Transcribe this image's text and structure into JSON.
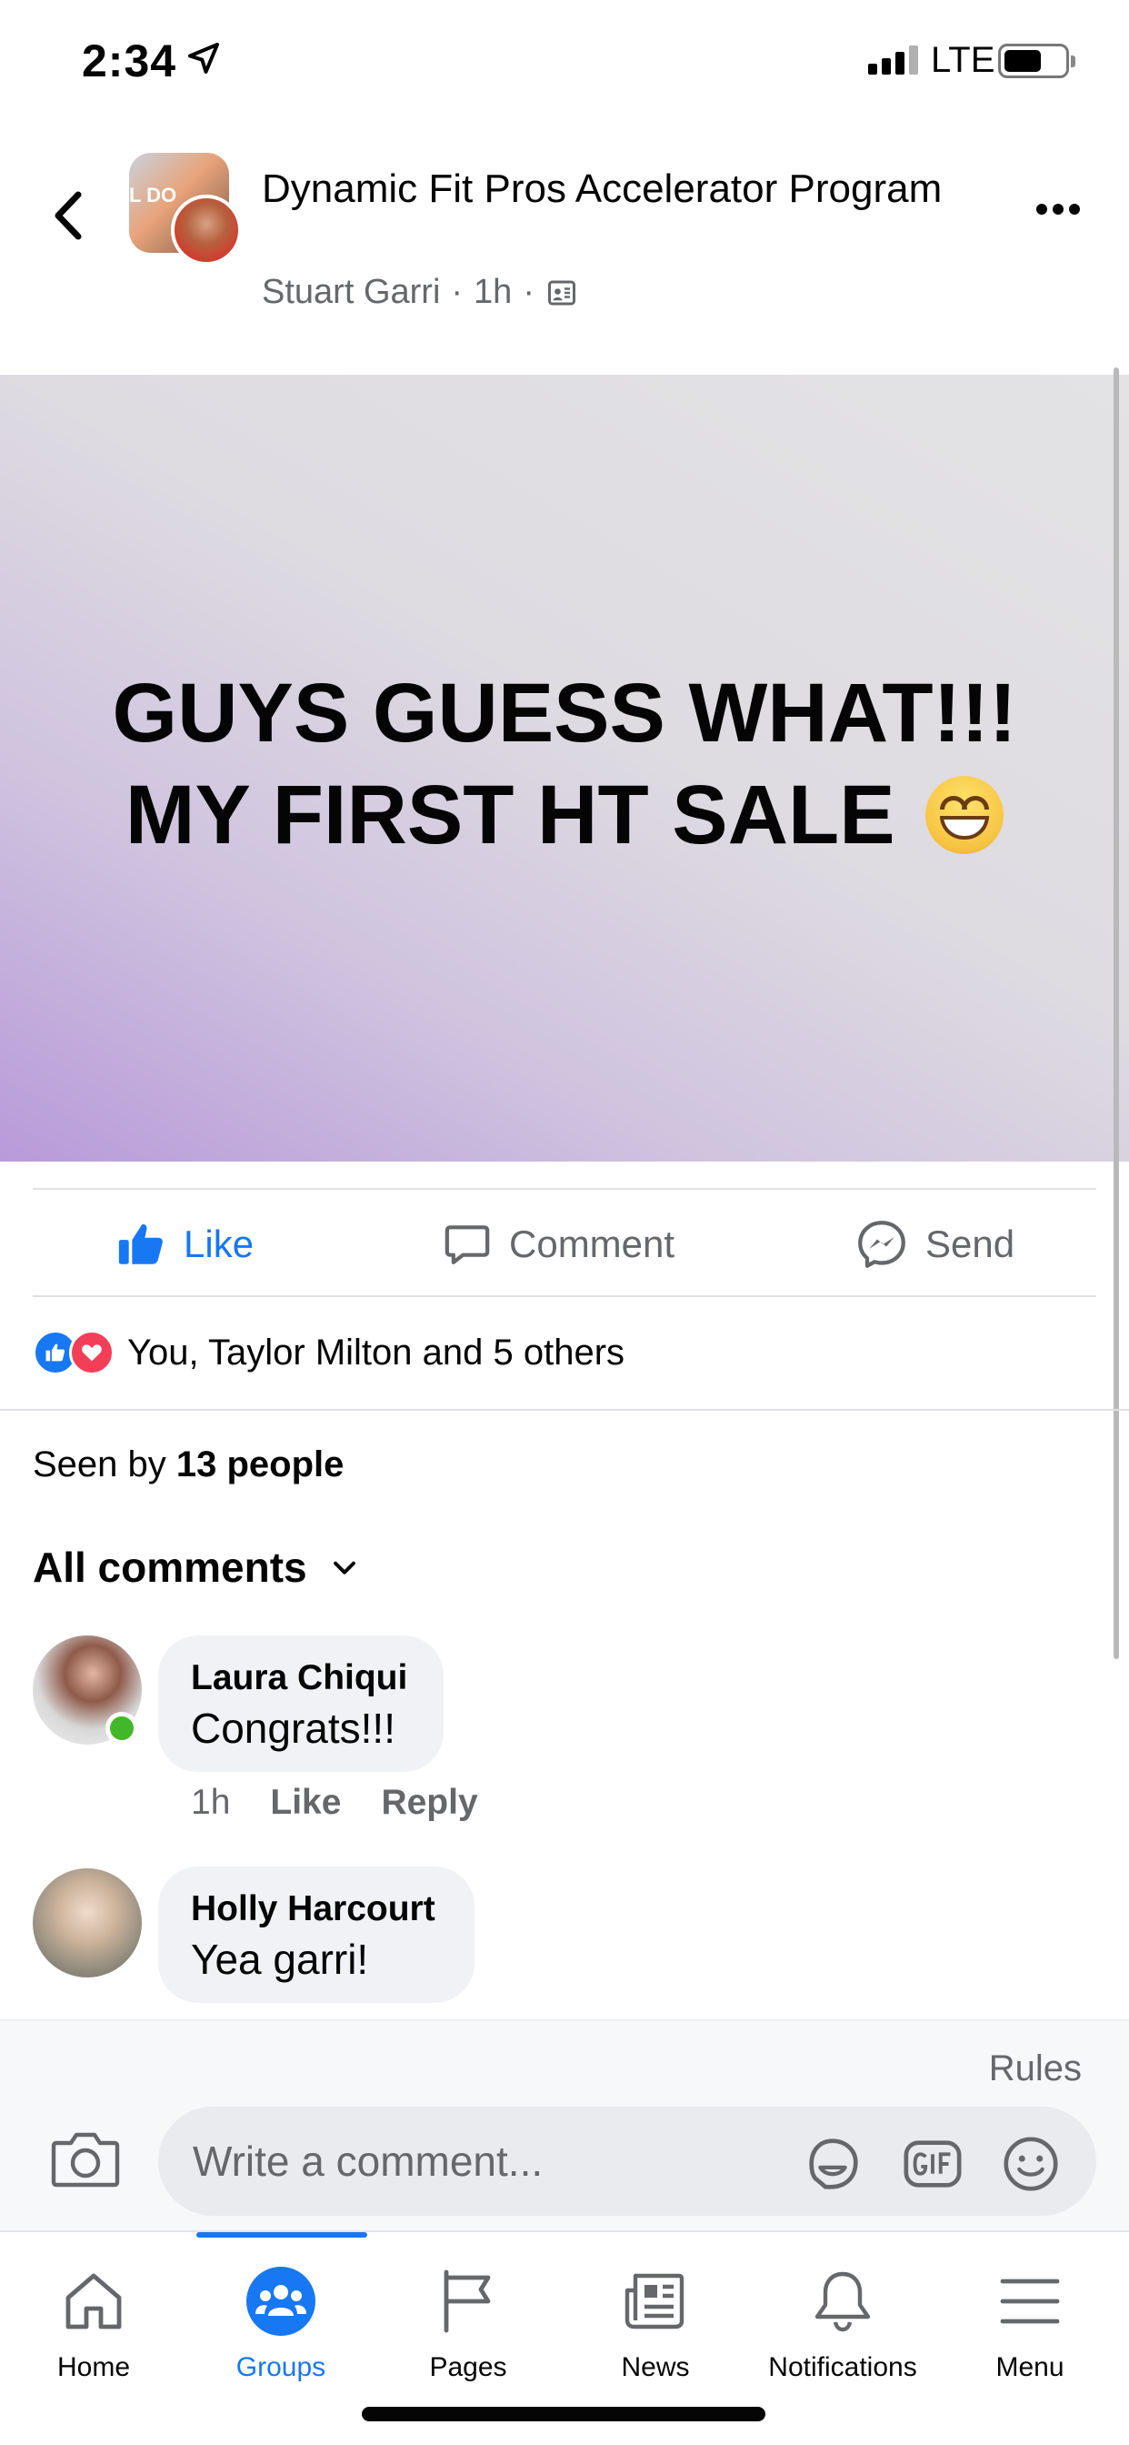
{
  "status_bar": {
    "time": "2:34",
    "network": "LTE"
  },
  "header": {
    "group_name": "Dynamic Fit Pros Accelerator Program",
    "author": "Stuart Garri",
    "time_ago": "1h",
    "separator": "·",
    "group_avatar_text": "L DO"
  },
  "post": {
    "line1": "GUYS GUESS WHAT!!!",
    "line2": "MY FIRST HT SALE"
  },
  "actions": {
    "like": "Like",
    "comment": "Comment",
    "send": "Send"
  },
  "reactions": {
    "summary": "You, Taylor Milton and 5 others"
  },
  "seen": {
    "prefix": "Seen by ",
    "count": "13 people"
  },
  "comments_header": "All comments",
  "comments": [
    {
      "name": "Laura Chiqui",
      "text": "Congrats!!!",
      "time": "1h",
      "like": "Like",
      "reply": "Reply"
    },
    {
      "name": "Holly Harcourt",
      "text": "Yea garri!"
    }
  ],
  "composer": {
    "rules": "Rules",
    "placeholder": "Write a comment..."
  },
  "tabs": [
    {
      "label": "Home"
    },
    {
      "label": "Groups"
    },
    {
      "label": "Pages"
    },
    {
      "label": "News"
    },
    {
      "label": "Notifications"
    },
    {
      "label": "Menu"
    }
  ],
  "colors": {
    "accent": "#1877f2",
    "love": "#f33e58",
    "secondary_text": "#65676b"
  }
}
